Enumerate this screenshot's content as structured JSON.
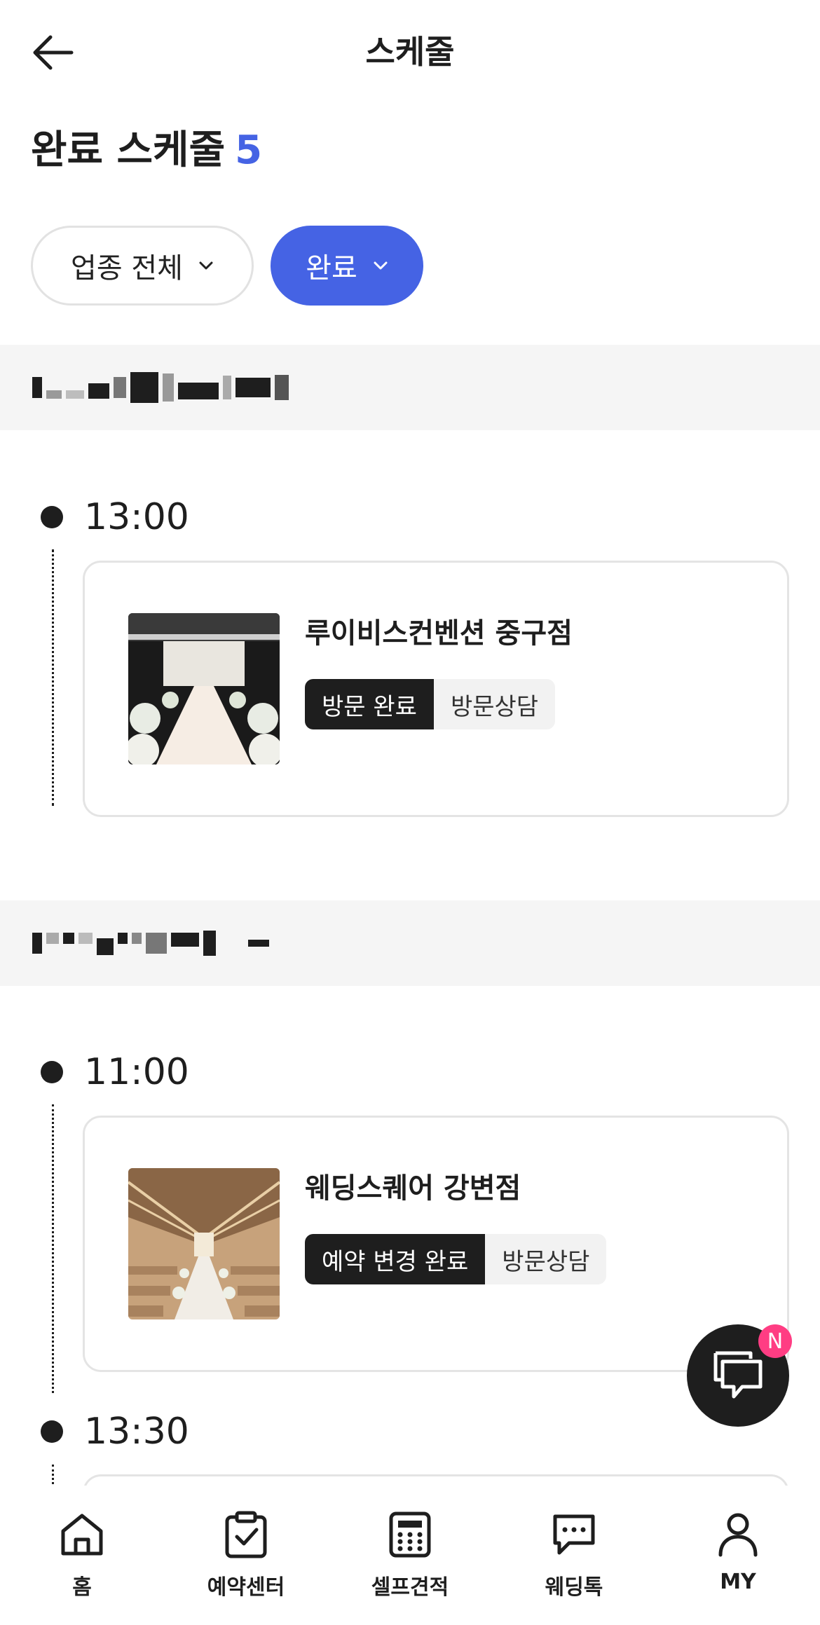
{
  "header": {
    "title": "스케줄",
    "back_icon": "arrow-left-icon"
  },
  "heading": {
    "text": "완료 스케줄",
    "count": "5",
    "count_color": "#4563e4"
  },
  "filters": {
    "category": "업종 전체",
    "status": "완료",
    "active_color": "#4563e4"
  },
  "groups": [
    {
      "entries": [
        {
          "time": "13:00",
          "venue": "루이비스컨벤션 중구점",
          "status_badge": "방문 완료",
          "type_badge": "방문상담"
        }
      ]
    },
    {
      "entries": [
        {
          "time": "11:00",
          "venue": "웨딩스퀘어 강변점",
          "status_badge": "예약 변경 완료",
          "type_badge": "방문상담"
        },
        {
          "time": "13:30"
        }
      ]
    }
  ],
  "chat": {
    "icon": "chat-bubbles-icon",
    "badge": "N",
    "badge_color": "#ff3d83"
  },
  "bottom_nav": [
    {
      "label": "홈",
      "icon": "home-icon"
    },
    {
      "label": "예약센터",
      "icon": "clipboard-check-icon"
    },
    {
      "label": "셀프견적",
      "icon": "calculator-icon"
    },
    {
      "label": "웨딩톡",
      "icon": "chat-dots-icon"
    },
    {
      "label": "MY",
      "icon": "user-icon"
    }
  ]
}
